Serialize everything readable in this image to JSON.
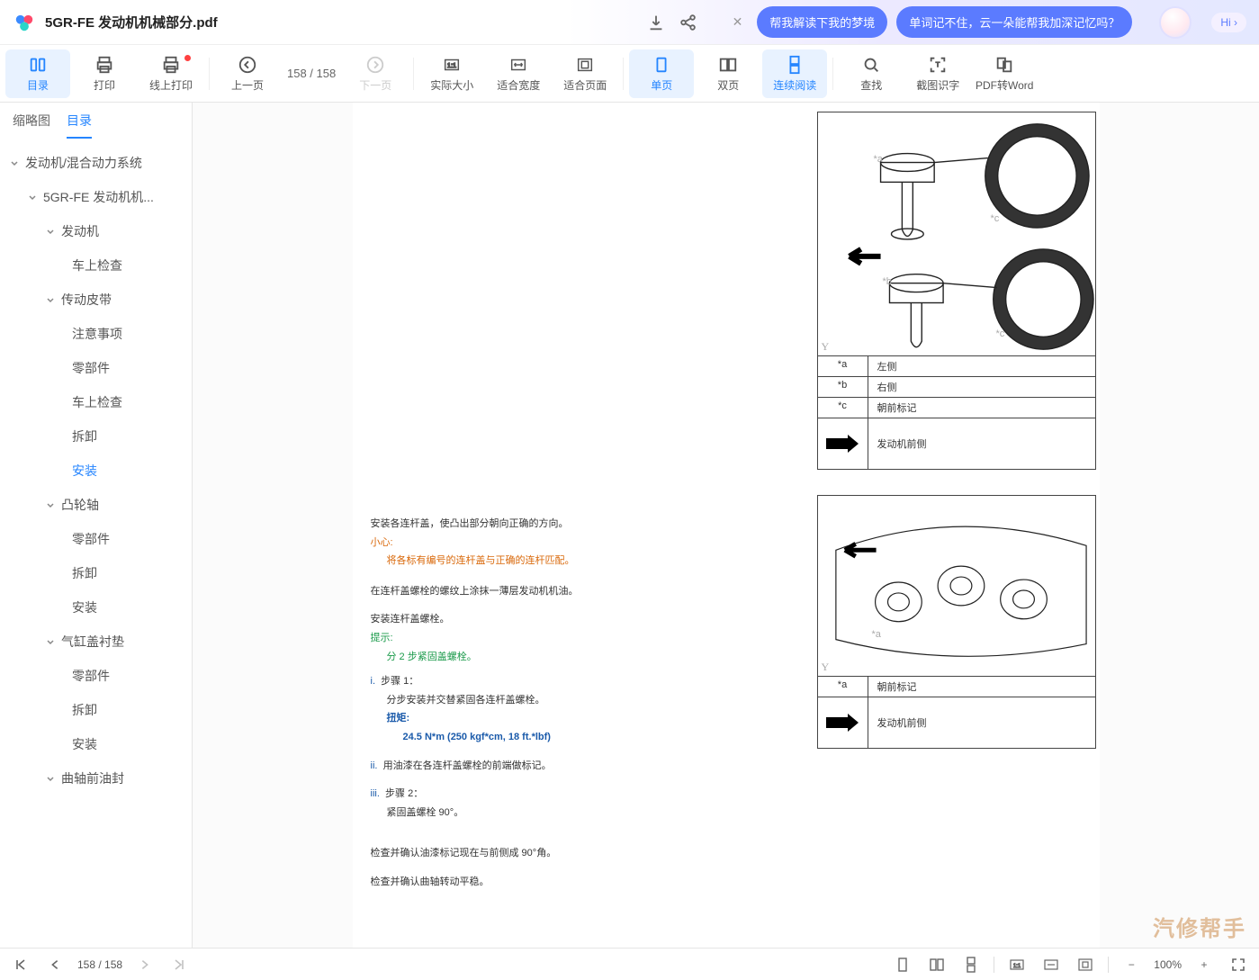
{
  "title": "5GR-FE 发动机机械部分.pdf",
  "pills": {
    "p1": "帮我解读下我的梦境",
    "p2": "单词记不住，云一朵能帮我加深记忆吗？",
    "hi": "Hi ›"
  },
  "toolbar": {
    "catalog": "目录",
    "print": "打印",
    "online_print": "线上打印",
    "prev": "上一页",
    "page": "158 / 158",
    "next": "下一页",
    "actual": "实际大小",
    "fitw": "适合宽度",
    "fitp": "适合页面",
    "single": "单页",
    "double": "双页",
    "cont": "连续阅读",
    "find": "查找",
    "ocr": "截图识字",
    "word": "PDF转Word"
  },
  "sidebar": {
    "tabs": {
      "thumb": "缩略图",
      "outline": "目录"
    },
    "tree": {
      "n0": "发动机/混合动力系统",
      "n1": "5GR-FE 发动机机...",
      "n2": "发动机",
      "n2_1": "车上检查",
      "n3": "传动皮带",
      "n3_1": "注意事项",
      "n3_2": "零部件",
      "n3_3": "车上检查",
      "n3_4": "拆卸",
      "n3_5": "安装",
      "n4": "凸轮轴",
      "n4_1": "零部件",
      "n4_2": "拆卸",
      "n4_3": "安装",
      "n5": "气缸盖衬垫",
      "n5_1": "零部件",
      "n5_2": "拆卸",
      "n5_3": "安装",
      "n6": "曲轴前油封"
    }
  },
  "diag1": {
    "y": "Y",
    "rows": {
      "a": "*a",
      "a_v": "左侧",
      "b": "*b",
      "b_v": "右侧",
      "c": "*c",
      "c_v": "朝前标记"
    },
    "arrow_label": "发动机前侧",
    "annot": {
      "a": "*a",
      "b": "*b",
      "c": "*c",
      "c2": "*c"
    }
  },
  "diag2": {
    "y": "Y",
    "rows": {
      "a": "*a",
      "a_v": "朝前标记"
    },
    "arrow_label": "发动机前侧",
    "annot": {
      "a": "*a"
    }
  },
  "body": {
    "l1": "安装各连杆盖，使凸出部分朝向正确的方向。",
    "caution_h": "小心:",
    "caution_b": "将各标有编号的连杆盖与正确的连杆匹配。",
    "l2": "在连杆盖螺栓的螺纹上涂抹一薄层发动机机油。",
    "l3": "安装连杆盖螺栓。",
    "tip_h": "提示:",
    "tip_b": "分 2 步紧固盖螺栓。",
    "s1_n": "i.",
    "s1_t": "步骤 1：",
    "s1_b": "分步安装并交替紧固各连杆盖螺栓。",
    "tq_h": "扭矩:",
    "tq_v": "24.5 N*m (250 kgf*cm, 18 ft.*lbf)",
    "s2_n": "ii.",
    "s2_t": "用油漆在各连杆盖螺栓的前端做标记。",
    "s3_n": "iii.",
    "s3_t": "步骤 2：",
    "s3_b": "紧固盖螺栓 90°。",
    "l4": "检查并确认油漆标记现在与前侧成 90°角。",
    "l5": "检查并确认曲轴转动平稳。"
  },
  "footer": {
    "page": "158 / 158",
    "zoom": "100%"
  },
  "watermark": "汽修帮手"
}
